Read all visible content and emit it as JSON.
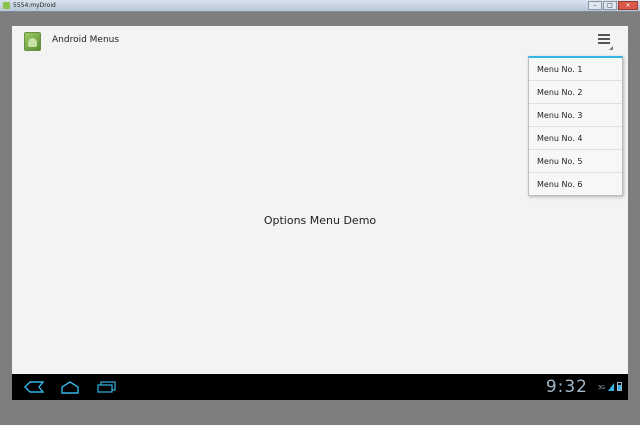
{
  "window": {
    "title": "5554:myDroid",
    "controls": [
      "–",
      "□",
      "✕"
    ]
  },
  "action_bar": {
    "app_icon": "android-app-icon",
    "title": "Android Menus",
    "overflow_icon": "overflow-menu-icon"
  },
  "options_menu": {
    "items": [
      {
        "label": "Menu No. 1"
      },
      {
        "label": "Menu No. 2"
      },
      {
        "label": "Menu No. 3"
      },
      {
        "label": "Menu No. 4"
      },
      {
        "label": "Menu No. 5"
      },
      {
        "label": "Menu No. 6"
      }
    ]
  },
  "content": {
    "center_text": "Options Menu Demo"
  },
  "system_bar": {
    "nav_icons": [
      "back-icon",
      "home-icon",
      "recent-apps-icon"
    ],
    "clock": "9:32",
    "network": "3G",
    "accent_color": "#33b5e5"
  }
}
